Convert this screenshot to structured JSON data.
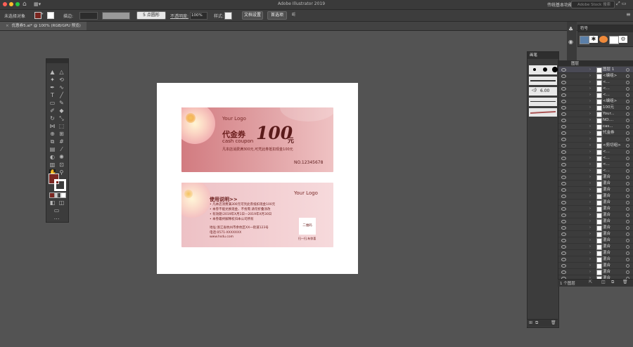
{
  "window": {
    "title": "Adobe Illustrator 2019",
    "workspace": "传统基本功能",
    "search_placeholder": "Adobe Stock 搜索"
  },
  "control_bar": {
    "selection": "未选择对象",
    "stroke_label": "描边:",
    "brush_label": "5 点圆形",
    "opacity_label": "不透明度:",
    "opacity_value": "100%",
    "style_label": "样式:",
    "doc_setup": "文档设置",
    "preferences": "首选项"
  },
  "tab": {
    "label": "优惠券5.ai* @ 100% (RGB/GPU 预览)"
  },
  "colors": {
    "fill": "#7a2620",
    "accent": "#c0272d",
    "panel": "#3c3c3c",
    "workspace": "#535353"
  },
  "symbols_panel": {
    "title": "符号"
  },
  "brushes_panel": {
    "title": "画笔",
    "brush_size": "6.00"
  },
  "layers_panel": {
    "tab": "图层",
    "footer": "1 个图层",
    "rows": [
      "图层 1",
      "<编组>",
      "<...",
      "<...",
      "<...",
      "<编组>",
      "100元",
      "Your...",
      "NO....",
      "cas...",
      "代金券",
      "",
      "<剪切组>",
      "<...",
      "<...",
      "<...",
      "<...",
      "混合",
      "混合",
      "混合",
      "混合",
      "混合",
      "混合",
      "混合",
      "混合",
      "混合",
      "混合",
      "混合",
      "混合",
      "混合",
      "混合",
      "混合",
      "混合",
      "混合"
    ]
  },
  "coupon_front": {
    "logo": "Your Logo",
    "title": "代金券",
    "subtitle": "cash coupon",
    "amount": "100",
    "unit": "元",
    "desc": "凡本店消费满300元,可凭此券抵扣现金100元",
    "number": "NO.12345678"
  },
  "coupon_back": {
    "heading": "使用说明>>",
    "logo": "Your Logo",
    "rules": [
      "• 凡本店消费满300元可凭此券抵扣现金100元",
      "• 本券不能兑换现金、不找零,请勿折叠涂改",
      "• 有效期:2019年X月1日—2019年X月30日",
      "• 本券最终解释权归本公司所有"
    ],
    "address": "地址:浙江省杭州市余杭区XX一街道123号",
    "phone": "电话:0571-XXXXXXX",
    "website": "www.hsdu.com",
    "qr_label": "二维码",
    "qr_caption": "扫一扫,有惊喜"
  }
}
